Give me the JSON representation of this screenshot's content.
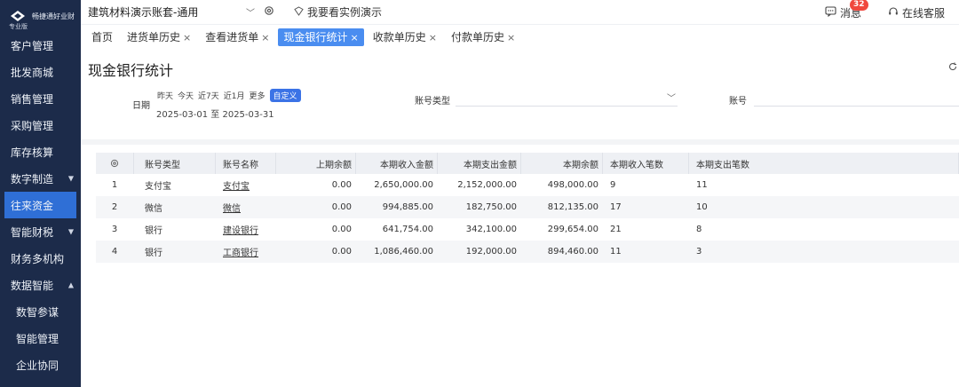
{
  "brand": {
    "name": "畅捷通好业财",
    "edition": "专业版"
  },
  "sidebar": {
    "items": [
      {
        "label": "客户管理",
        "arrow": ""
      },
      {
        "label": "批发商城",
        "arrow": ""
      },
      {
        "label": "销售管理",
        "arrow": ""
      },
      {
        "label": "采购管理",
        "arrow": ""
      },
      {
        "label": "库存核算",
        "arrow": ""
      },
      {
        "label": "数字制造",
        "arrow": "▼"
      },
      {
        "label": "往来资金",
        "arrow": ""
      },
      {
        "label": "智能财税",
        "arrow": "▼"
      },
      {
        "label": "财务多机构",
        "arrow": ""
      },
      {
        "label": "数据智能",
        "arrow": "▲"
      },
      {
        "label": "数智参谋",
        "arrow": ""
      },
      {
        "label": "智能管理",
        "arrow": ""
      },
      {
        "label": "企业协同",
        "arrow": ""
      }
    ]
  },
  "topbar": {
    "account": "建筑材料演示账套-通用",
    "demo_link": "我要看实例演示",
    "messages_label": "消息",
    "messages_count": "32",
    "support_label": "在线客服"
  },
  "tabs": [
    {
      "label": "首页",
      "close": ""
    },
    {
      "label": "进货单历史",
      "close": "×"
    },
    {
      "label": "查看进货单",
      "close": "×"
    },
    {
      "label": "现金银行统计",
      "close": "×"
    },
    {
      "label": "收款单历史",
      "close": "×"
    },
    {
      "label": "付款单历史",
      "close": "×"
    }
  ],
  "page": {
    "title": "现金银行统计",
    "filters": {
      "date_label": "日期",
      "quick": [
        "昨天",
        "今天",
        "近7天",
        "近1月",
        "更多"
      ],
      "custom": "自定义",
      "range": "2025-03-01 至 2025-03-31",
      "account_type_label": "账号类型",
      "account_type_value": "",
      "account_label": "账号",
      "account_value": ""
    }
  },
  "table": {
    "headers": [
      "",
      "账号类型",
      "账号名称",
      "上期余额",
      "本期收入金额",
      "本期支出金额",
      "本期余额",
      "本期收入笔数",
      "本期支出笔数"
    ],
    "rows": [
      [
        "1",
        "支付宝",
        "支付宝",
        "0.00",
        "2,650,000.00",
        "2,152,000.00",
        "498,000.00",
        "9",
        "11"
      ],
      [
        "2",
        "微信",
        "微信",
        "0.00",
        "994,885.00",
        "182,750.00",
        "812,135.00",
        "17",
        "10"
      ],
      [
        "3",
        "银行",
        "建设银行",
        "0.00",
        "641,754.00",
        "342,100.00",
        "299,654.00",
        "21",
        "8"
      ],
      [
        "4",
        "银行",
        "工商银行",
        "0.00",
        "1,086,460.00",
        "192,000.00",
        "894,460.00",
        "11",
        "3"
      ]
    ]
  },
  "colors": {
    "sidebar_bg": "#1c2b4a",
    "accent": "#4a8df0",
    "active_nav": "#2f6fd6",
    "badge": "#f0483e"
  },
  "icons": {
    "gear": "gear-icon",
    "demo": "shield-icon",
    "message": "chat-icon",
    "support": "headset-icon",
    "refresh": "refresh-icon"
  }
}
